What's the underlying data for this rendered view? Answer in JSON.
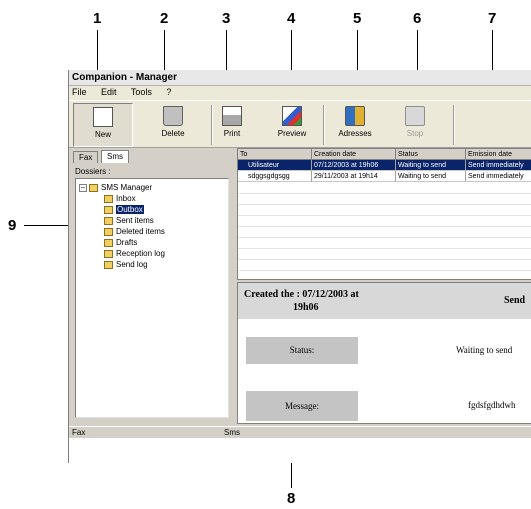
{
  "callouts": [
    "1",
    "2",
    "3",
    "4",
    "5",
    "6",
    "7",
    "8",
    "9"
  ],
  "app": {
    "title": "Companion - Manager",
    "menu": [
      "File",
      "Edit",
      "Tools",
      "?"
    ]
  },
  "toolbar": {
    "new": "New",
    "delete": "Delete",
    "print": "Print",
    "preview": "Preview",
    "addresses": "Adresses",
    "stop": "Stop"
  },
  "left_panel": {
    "tabs": [
      "Fax",
      "Sms"
    ],
    "active_tab": "Sms",
    "dossiers_label": "Dossiers :",
    "tree": {
      "root": "SMS Manager",
      "children": [
        "Inbox",
        "Outbox",
        "Sent items",
        "Deleted items",
        "Drafts",
        "Reception log",
        "Send log"
      ],
      "selected": "Outbox"
    }
  },
  "grid": {
    "columns": [
      "To",
      "Creation date",
      "Status",
      "Emission date"
    ],
    "rows": [
      [
        "Utilisateur",
        "07/12/2003 at 19h06",
        "Waiting to send",
        "Send immediately"
      ],
      [
        "sdggsgdgsgg",
        "29/11/2003 at 19h14",
        "Waiting to send",
        "Send immediately"
      ]
    ],
    "selected_row": 0
  },
  "detail": {
    "created_line1": "Created the : 07/12/2003 at",
    "created_line2": "19h06",
    "send_label": "Send",
    "status_label": "Status:",
    "status_value": "Waiting to send",
    "message_label": "Message:",
    "message_value": "fgdsfgdhdwh"
  },
  "status_bar": {
    "left": "Fax",
    "right": "Sms"
  },
  "colors": {
    "selection": "#0a246a",
    "window_face": "#d4d0c8",
    "detail_box": "#c4c4c4"
  }
}
